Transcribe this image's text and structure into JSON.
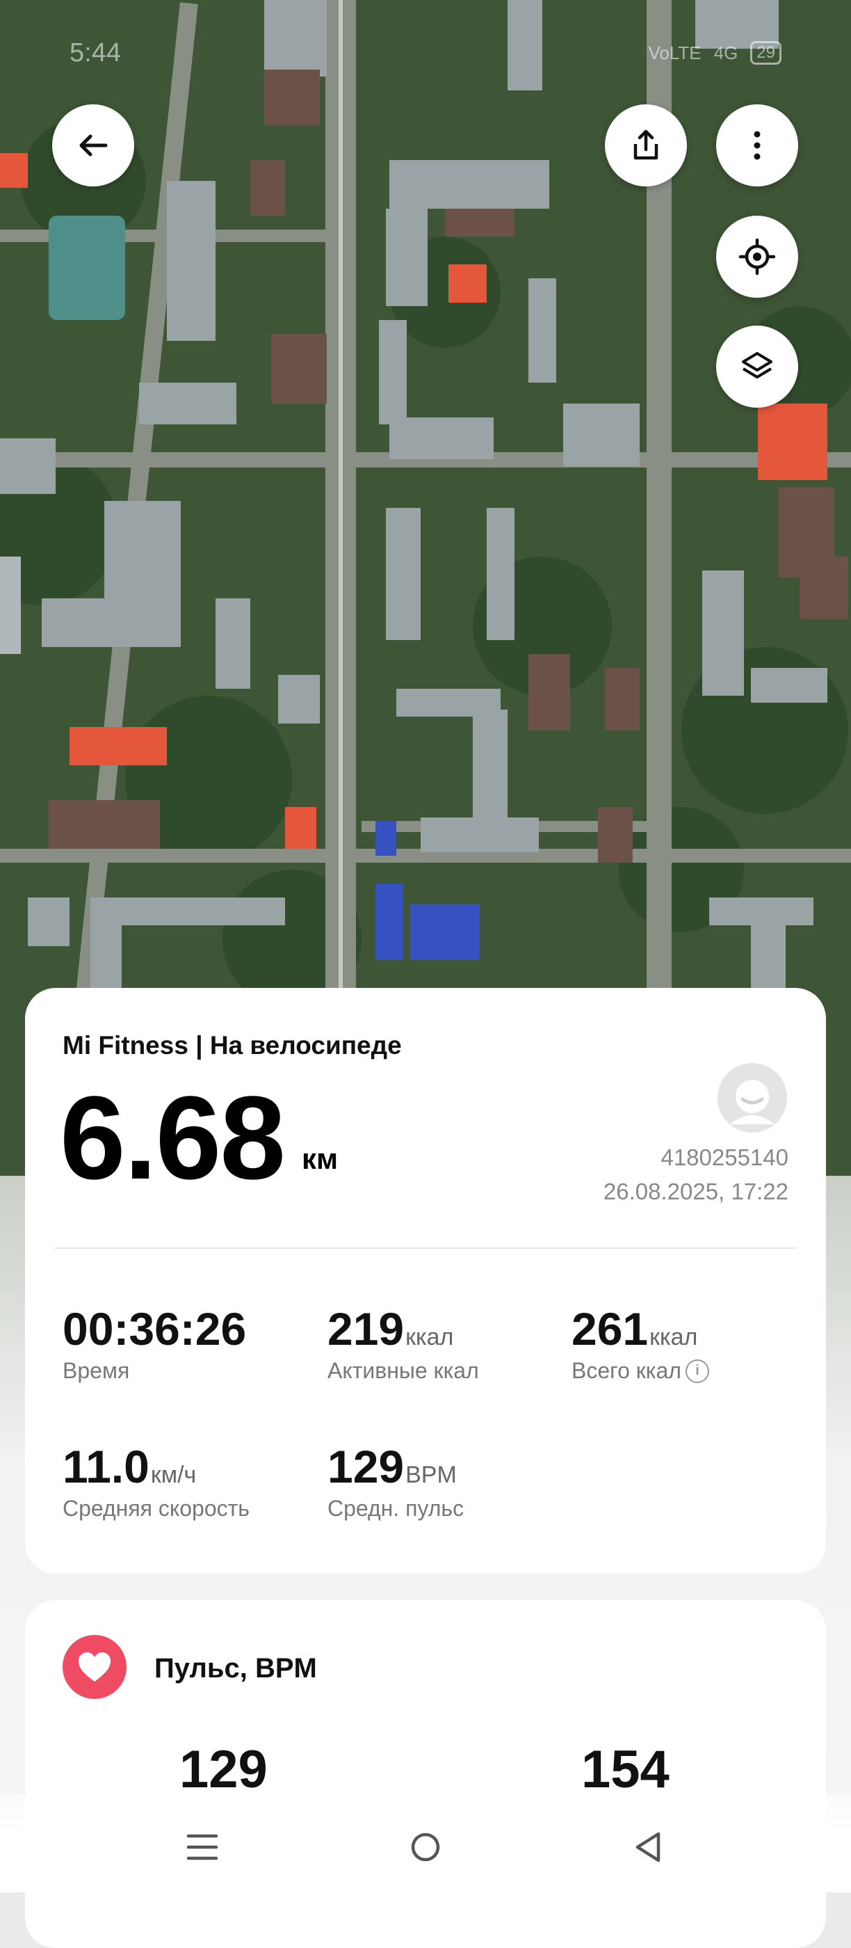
{
  "status_bar": {
    "time": "5:44",
    "network": "VoLTE",
    "signal": "4G",
    "battery": "29"
  },
  "map": {
    "buttons": {
      "back_icon": "arrow-left-icon",
      "share_icon": "share-icon",
      "more_icon": "more-vertical-icon",
      "locate_icon": "locate-icon",
      "layers_icon": "layers-icon"
    }
  },
  "workout": {
    "source": "Mi Fitness | На велосипеде",
    "distance": "6.68",
    "distance_unit": "км",
    "user_id": "4180255140",
    "datetime": "26.08.2025, 17:22",
    "stats": [
      {
        "value": "00:36:26",
        "unit": "",
        "label": "Время"
      },
      {
        "value": "219",
        "unit": "ккал",
        "label": "Активные ккал"
      },
      {
        "value": "261",
        "unit": "ккал",
        "label": "Всего ккал"
      },
      {
        "value": "11.0",
        "unit": "км/ч",
        "label": "Средняя скорость"
      },
      {
        "value": "129",
        "unit": "BPM",
        "label": "Средн. пульс"
      }
    ]
  },
  "heart_rate": {
    "title": "Пульс, BPM",
    "values": [
      "129",
      "154"
    ]
  },
  "colors": {
    "heart": "#ef4b63",
    "card": "#ffffff",
    "muted_text": "#888888"
  }
}
